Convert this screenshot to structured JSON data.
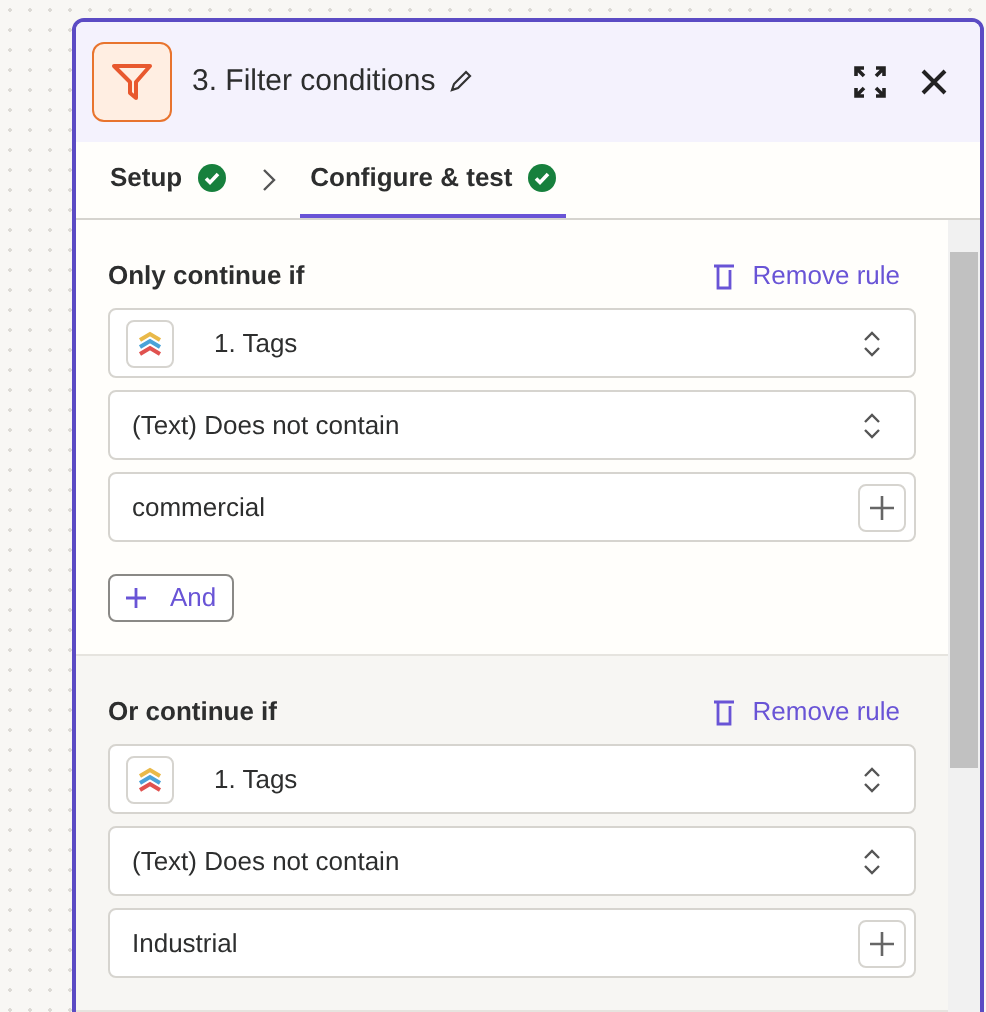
{
  "panel": {
    "title": "3. Filter conditions"
  },
  "tabs": [
    {
      "label": "Setup",
      "selected": false,
      "complete": true
    },
    {
      "label": "Configure & test",
      "selected": true,
      "complete": true
    }
  ],
  "rules": [
    {
      "heading": "Only continue if",
      "remove_label": "Remove rule",
      "field": "1. Tags",
      "operator": "(Text) Does not contain",
      "value": "commercial",
      "and_button": "And"
    },
    {
      "heading": "Or continue if",
      "remove_label": "Remove rule",
      "field": "1. Tags",
      "operator": "(Text) Does not contain",
      "value": "Industrial"
    }
  ]
}
